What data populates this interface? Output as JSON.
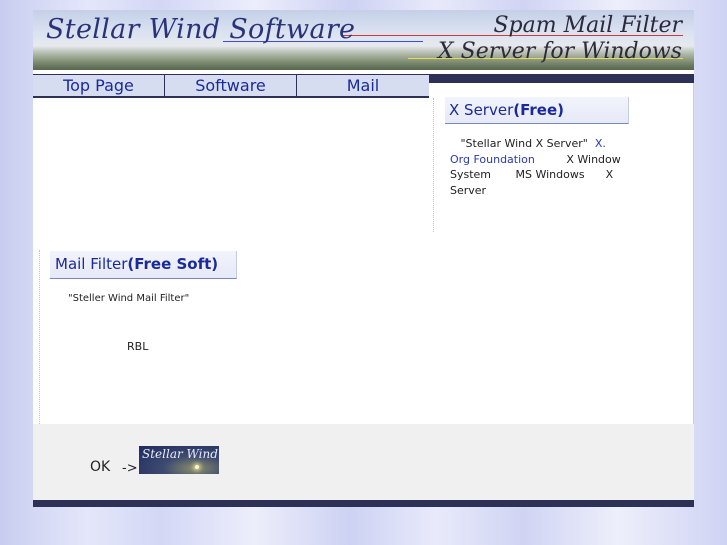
{
  "banner": {
    "title": "Stellar Wind Software",
    "line1": "Spam Mail Filter",
    "line2": "X Server for Windows"
  },
  "nav": {
    "tabs": [
      {
        "label": "Top Page"
      },
      {
        "label": "Software"
      },
      {
        "label": "Mail"
      }
    ]
  },
  "xserver": {
    "heading_main": "X Server",
    "heading_bold": "(Free)",
    "text_1": "\"Stellar Wind X Server\"",
    "link_1": "X. Org Foundation",
    "text_2": "X Window System",
    "text_3": "MS Windows",
    "text_4": "X Server"
  },
  "mailfilter": {
    "heading_main": "Mail Filter",
    "heading_bold": "(Free Soft)",
    "text_1": "\"Steller Wind Mail Filter\"",
    "rbl": "RBL"
  },
  "footer": {
    "ok": "OK",
    "arrow": "->",
    "logo_text": "Stellar Wind"
  },
  "colors": {
    "navy": "#2d3156",
    "link_blue": "#1a2a9a",
    "nav_bg": "#d6ddf0"
  }
}
